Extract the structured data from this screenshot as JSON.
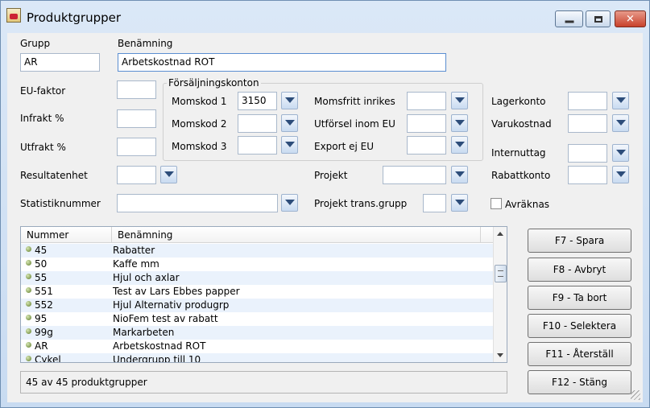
{
  "window": {
    "title": "Produktgrupper"
  },
  "fields": {
    "grupp_label": "Grupp",
    "grupp_value": "AR",
    "benamning_label": "Benämning",
    "benamning_value": "Arbetskostnad ROT",
    "eu_faktor_label": "EU-faktor",
    "infrakt_label": "Infrakt %",
    "utfrakt_label": "Utfrakt %",
    "resultatenhet_label": "Resultatenhet",
    "statistiknummer_label": "Statistiknummer",
    "forsaljningskonton_label": "Försäljningskonton",
    "momskod1_label": "Momskod 1",
    "momskod1_value": "3150",
    "momskod2_label": "Momskod 2",
    "momskod3_label": "Momskod 3",
    "momsfritt_label": "Momsfritt inrikes",
    "utforsel_label": "Utförsel inom EU",
    "export_label": "Export ej EU",
    "projekt_label": "Projekt",
    "projekt_trans_label": "Projekt trans.grupp",
    "lagerkonto_label": "Lagerkonto",
    "varukostnad_label": "Varukostnad",
    "internuttag_label": "Internuttag",
    "rabattkonto_label": "Rabattkonto",
    "avraknas_label": "Avräknas"
  },
  "list": {
    "columns": [
      "Nummer",
      "Benämning"
    ],
    "rows": [
      {
        "nummer": "45",
        "benamning": "Rabatter"
      },
      {
        "nummer": "50",
        "benamning": "Kaffe mm"
      },
      {
        "nummer": "55",
        "benamning": "Hjul och axlar"
      },
      {
        "nummer": "551",
        "benamning": "Test av Lars Ebbes papper"
      },
      {
        "nummer": "552",
        "benamning": "Hjul Alternativ produgrp"
      },
      {
        "nummer": "95",
        "benamning": "NioFem test av rabatt"
      },
      {
        "nummer": "99g",
        "benamning": "Markarbeten"
      },
      {
        "nummer": "AR",
        "benamning": "Arbetskostnad ROT"
      },
      {
        "nummer": "Cykel",
        "benamning": "Undergrupp till 10"
      }
    ]
  },
  "status": {
    "text": "45 av 45 produktgrupper"
  },
  "buttons": {
    "spara": "F7 - Spara",
    "avbryt": "F8 - Avbryt",
    "ta_bort": "F9 - Ta bort",
    "selektera": "F10 - Selektera",
    "aterstall": "F11 - Återställ",
    "stang": "F12 - Stäng"
  }
}
